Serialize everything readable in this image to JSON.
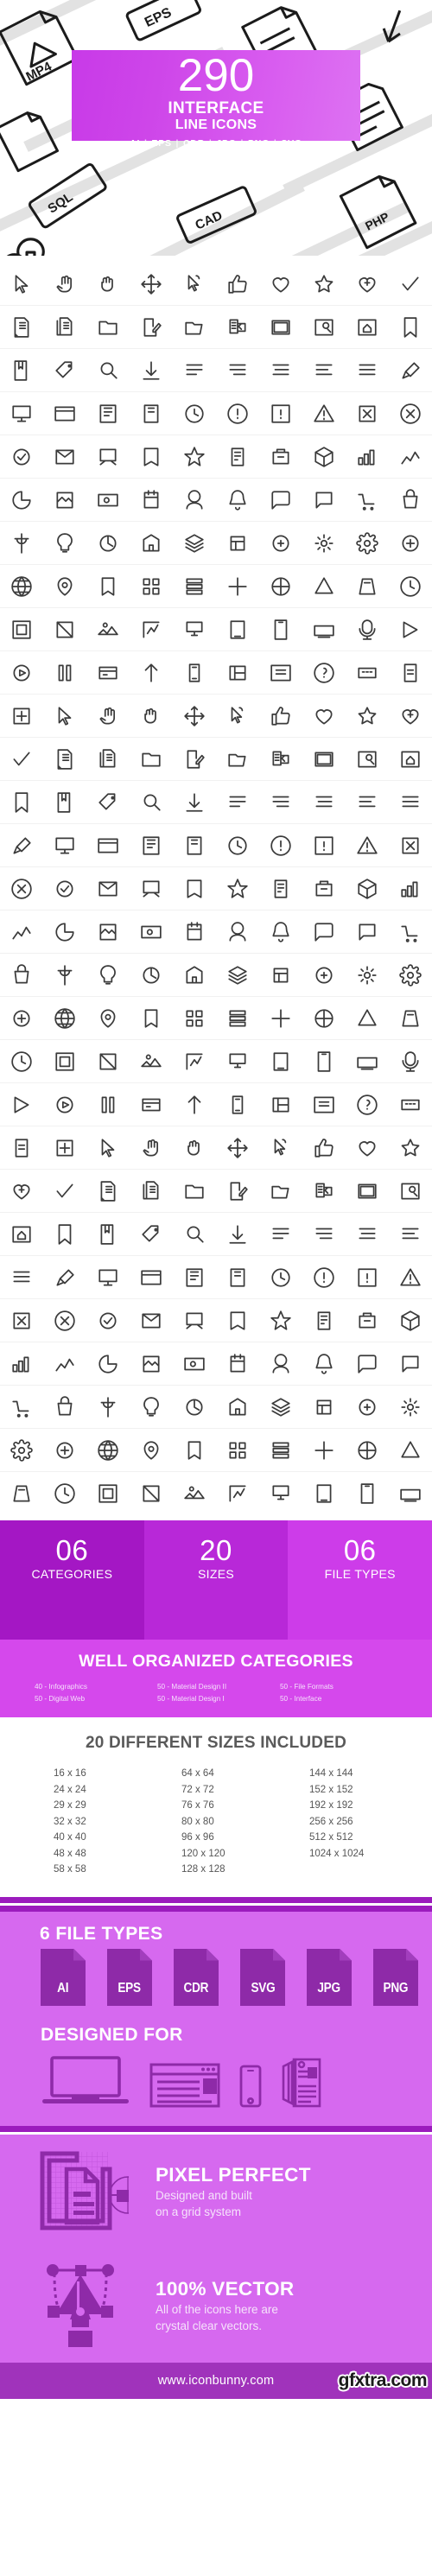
{
  "hero": {
    "count": "290",
    "title": "INTERFACE",
    "subtitle": "LINE ICONS",
    "formats": [
      "AI",
      "EPS",
      "CDR",
      "JPG",
      "PNG",
      "SVG"
    ],
    "separator": "|",
    "banner_color": "#cd3ce9",
    "background_labels": [
      "MP4",
      "EPS",
      "SQL",
      "CAD",
      "PHP"
    ]
  },
  "icon_grid": {
    "columns": 10,
    "rows": 29,
    "total_icons": 290,
    "stroke_color": "#3b3b3b",
    "row_separator_color": "#f1f1f1"
  },
  "stats": [
    {
      "number": "06",
      "label": "CATEGORIES",
      "color": "#a417c4"
    },
    {
      "number": "20",
      "label": "SIZES",
      "color": "#b828d8"
    },
    {
      "number": "06",
      "label": "FILE TYPES",
      "color": "#cd3ce9"
    }
  ],
  "categories": {
    "heading": "WELL ORGANIZED CATEGORIES",
    "band_color": "#d548ec",
    "columns": [
      [
        "40 - Infographics",
        "50 - Digital Web"
      ],
      [
        "50 - Material Design II",
        "50 - Material Design I"
      ],
      [
        "50 - File Formats",
        "50 - Interface"
      ]
    ]
  },
  "sizes": {
    "heading": "20 DIFFERENT SIZES INCLUDED",
    "columns": [
      [
        "16 x 16",
        "24 x 24",
        "29 x 29",
        "32 x 32",
        "40 x 40",
        "48 x 48",
        "58 x 58"
      ],
      [
        "64 x 64",
        "72 x 72",
        "76 x 76",
        "80 x 80",
        "96 x 96",
        "120 x 120",
        "128 x 128"
      ],
      [
        "144 x 144",
        "152 x 152",
        "192 x 192",
        "256 x 256",
        "512 x 512",
        "1024 x 1024"
      ]
    ]
  },
  "file_types": {
    "heading": "6 FILE TYPES",
    "items": [
      "AI",
      "EPS",
      "CDR",
      "SVG",
      "JPG",
      "PNG"
    ],
    "band_color": "#d669ef",
    "badge_color": "#8e2aa8"
  },
  "designed_for": {
    "heading": "DESIGNED FOR",
    "devices": [
      "laptop-icon",
      "browser-window-icon",
      "smartphone-icon",
      "documents-icon"
    ]
  },
  "features": [
    {
      "title": "PIXEL PERFECT",
      "desc_line1": "Designed and built",
      "desc_line2": "on a grid system",
      "icon": "pixel-grid-icon"
    },
    {
      "title": "100% VECTOR",
      "desc_line1": "All of the icons here are",
      "desc_line2": "crystal clear vectors.",
      "icon": "pen-nib-icon"
    }
  ],
  "footer": {
    "url": "www.iconbunny.com",
    "watermark": "gfxtra.com",
    "bar_color": "#a033bb"
  }
}
